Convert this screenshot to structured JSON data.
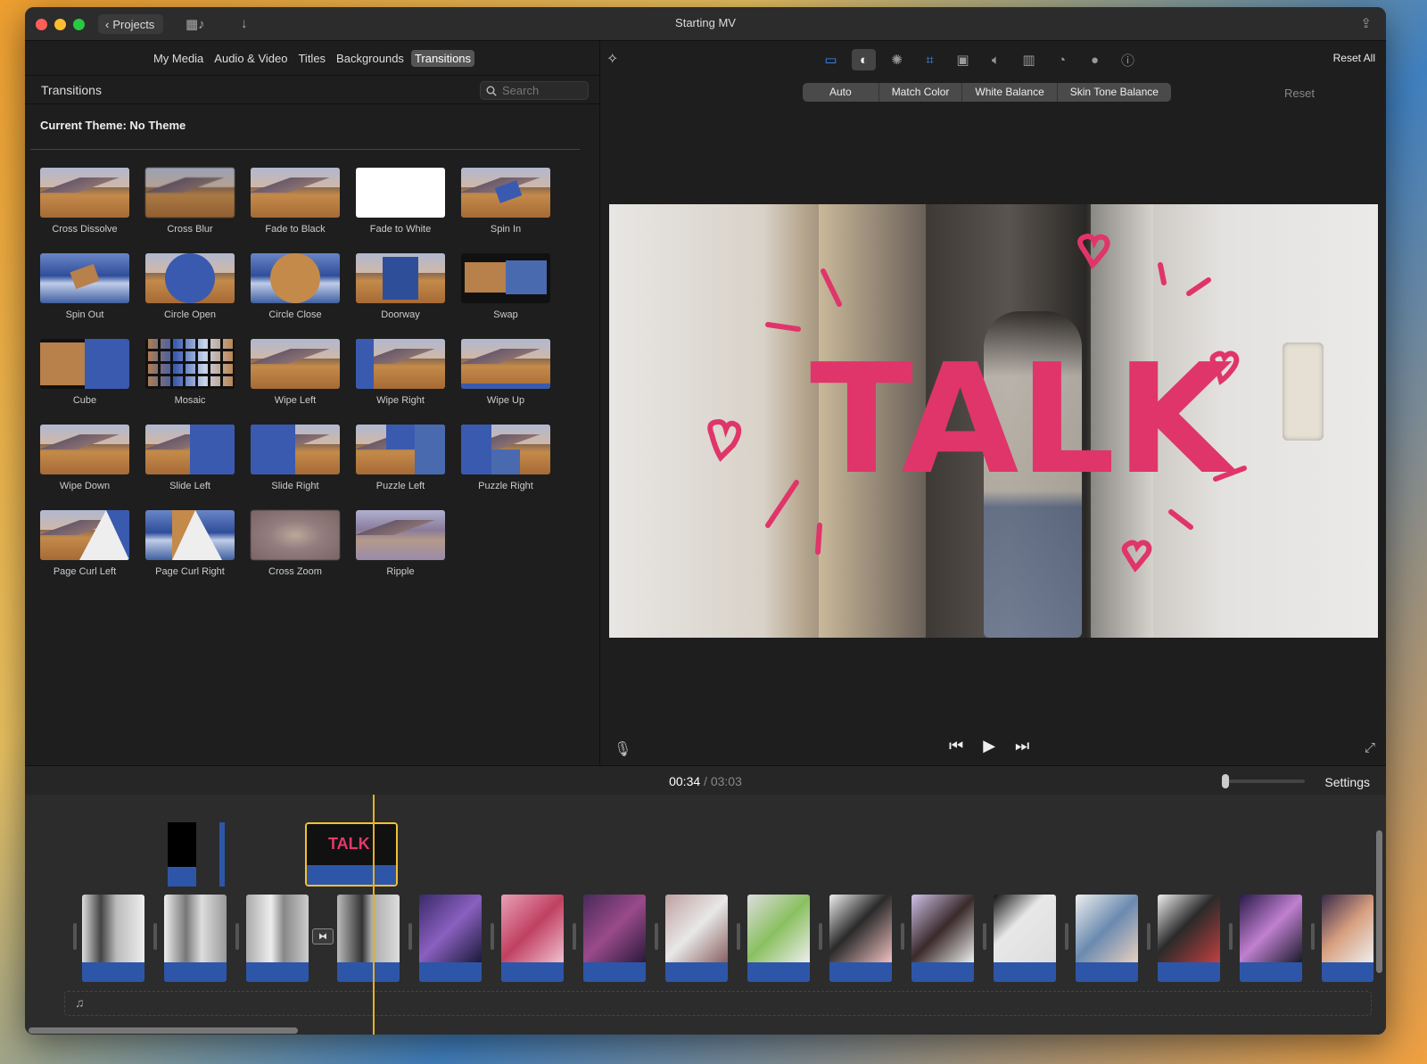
{
  "window": {
    "title": "Starting MV",
    "projects_label": "Projects"
  },
  "browser": {
    "tabs": [
      {
        "label": "My Media",
        "active": false
      },
      {
        "label": "Audio & Video",
        "active": false
      },
      {
        "label": "Titles",
        "active": false
      },
      {
        "label": "Backgrounds",
        "active": false
      },
      {
        "label": "Transitions",
        "active": true
      }
    ],
    "header_title": "Transitions",
    "search_placeholder": "Search",
    "theme_label": "Current Theme: No Theme",
    "transitions": [
      "Cross Dissolve",
      "Cross Blur",
      "Fade to Black",
      "Fade to White",
      "Spin In",
      "Spin Out",
      "Circle Open",
      "Circle Close",
      "Doorway",
      "Swap",
      "Cube",
      "Mosaic",
      "Wipe Left",
      "Wipe Right",
      "Wipe Up",
      "Wipe Down",
      "Slide Left",
      "Slide Right",
      "Puzzle Left",
      "Puzzle Right",
      "Page Curl Left",
      "Page Curl Right",
      "Cross Zoom",
      "Ripple"
    ]
  },
  "viewer": {
    "reset_all_label": "Reset All",
    "color_buttons": [
      "Auto",
      "Match Color",
      "White Balance",
      "Skin Tone Balance"
    ],
    "reset_label": "Reset",
    "overlay_text": "TALK"
  },
  "timeline": {
    "current_time": "00:34",
    "separator": "/",
    "total_time": "03:03",
    "settings_label": "Settings",
    "title_clip_text": "TALK"
  },
  "colors": {
    "accent_blue": "#3a8ef6",
    "audio_blue": "#2d56a8",
    "playhead": "#e6b020",
    "talk_pink": "#e23a6a"
  }
}
